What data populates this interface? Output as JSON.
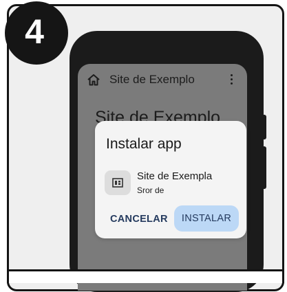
{
  "step": {
    "number": "4"
  },
  "browser": {
    "title": "Site de Exemplo",
    "page_heading": "Site de Exemplo",
    "icons": {
      "home": "home-icon",
      "menu": "more-vert-icon"
    }
  },
  "dialog": {
    "title": "Instalar app",
    "app_name": "Site de Exempla",
    "app_subtitle": "Sror de",
    "app_icon": "app-grid-icon",
    "cancel_label": "CANCELAR",
    "install_label": "INSTALAR"
  },
  "colors": {
    "badge": "#151515",
    "phone_body": "#1b1b1b",
    "screen_dim": "#7b7b7b",
    "dialog_bg": "#f4f4f4",
    "install_button": "#bcd8f6",
    "button_text": "#243a5e"
  }
}
